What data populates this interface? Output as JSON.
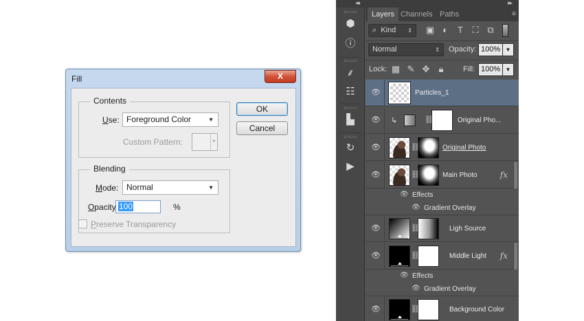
{
  "fill_dialog": {
    "title": "Fill",
    "close_label": "X",
    "contents_group": "Contents",
    "use_label": "Use:",
    "use_value": "Foreground Color",
    "custom_pattern_label": "Custom Pattern:",
    "blending_group": "Blending",
    "mode_label": "Mode:",
    "mode_value": "Normal",
    "opacity_label": "Opacity:",
    "opacity_value": "100",
    "opacity_unit": "%",
    "preserve_transparency_label": "Preserve Transparency",
    "ok_label": "OK",
    "cancel_label": "Cancel"
  },
  "layers_panel": {
    "collapse_left": "◂◂",
    "collapse_right": "▸▸",
    "tabs": [
      {
        "label": "Layers",
        "active": true
      },
      {
        "label": "Channels",
        "active": false
      },
      {
        "label": "Paths",
        "active": false
      }
    ],
    "menu_icon": "≡",
    "filter": {
      "search_icon": "⌕",
      "kind_label": "Kind"
    },
    "blend_mode": "Normal",
    "opacity_label": "Opacity:",
    "opacity_value": "100%",
    "lock_label": "Lock:",
    "fill_label": "Fill:",
    "fill_value": "100%",
    "layers": [
      {
        "name": "Particles_1"
      },
      {
        "name": "Original Pho..."
      },
      {
        "name": "Original Photo"
      },
      {
        "name": "Main Photo",
        "effects": "Effects",
        "effect_item": "Gradient Overlay"
      },
      {
        "name": "Ligh Source"
      },
      {
        "name": "Middle Light",
        "effects": "Effects",
        "effect_item": "Gradient Overlay"
      },
      {
        "name": "Background Color"
      }
    ],
    "fx_label": "fx"
  }
}
